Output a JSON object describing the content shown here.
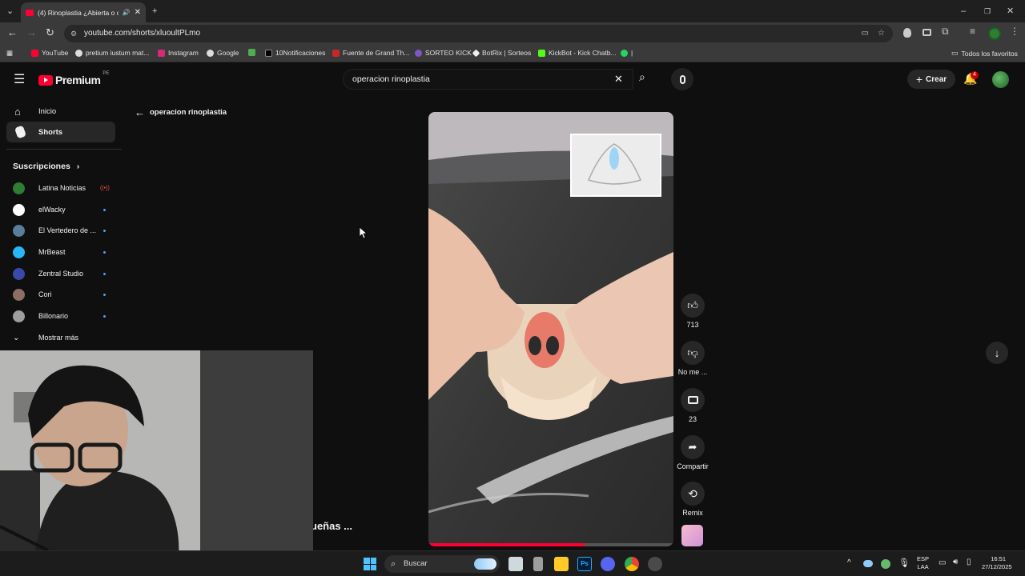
{
  "browser": {
    "tab_title": "(4) Rinoplastia ¿Abierta o c",
    "url": "youtube.com/shorts/xluoultPLmo",
    "bookmarks": [
      "YouTube",
      "pretium iustum mat...",
      "Instagram",
      "Google",
      "10Notificaciones",
      "Fuente de Grand Th...",
      "SORTEO KICK",
      "BotRix | Sorteos",
      "KickBot - Kick Chatb...",
      "|"
    ],
    "all_bookmarks": "Todos los favoritos"
  },
  "youtube": {
    "logo_text": "Premium",
    "logo_region": "PE",
    "search_value": "operacion rinoplastia",
    "create_label": "Crear",
    "notif_count": "4"
  },
  "sidebar": {
    "home": "Inicio",
    "shorts": "Shorts",
    "subs_header": "Suscripciones",
    "subs": [
      {
        "name": "Latina Noticias",
        "color": "#2e7d32"
      },
      {
        "name": "elWacky",
        "color": "#ffffff"
      },
      {
        "name": "El Vertedero de ...",
        "color": "#5a7d9a"
      },
      {
        "name": "MrBeast",
        "color": "#29b6f6"
      },
      {
        "name": "Zentral Studio",
        "color": "#3949ab"
      },
      {
        "name": "Cori",
        "color": "#8d6e63"
      },
      {
        "name": "Billonario",
        "color": "#9e9e9e"
      }
    ],
    "more": "Mostrar más"
  },
  "main": {
    "back_label": "operacion rinoplastia",
    "caption_fragment": "ueñas ..."
  },
  "actions": {
    "likes": "713",
    "dislike": "No me ...",
    "comments": "23",
    "share": "Compartir",
    "remix": "Remix"
  },
  "taskbar": {
    "search": "Buscar",
    "lang1": "ESP",
    "lang2": "LAA",
    "time": "16:51",
    "date": "27/12/2025"
  }
}
